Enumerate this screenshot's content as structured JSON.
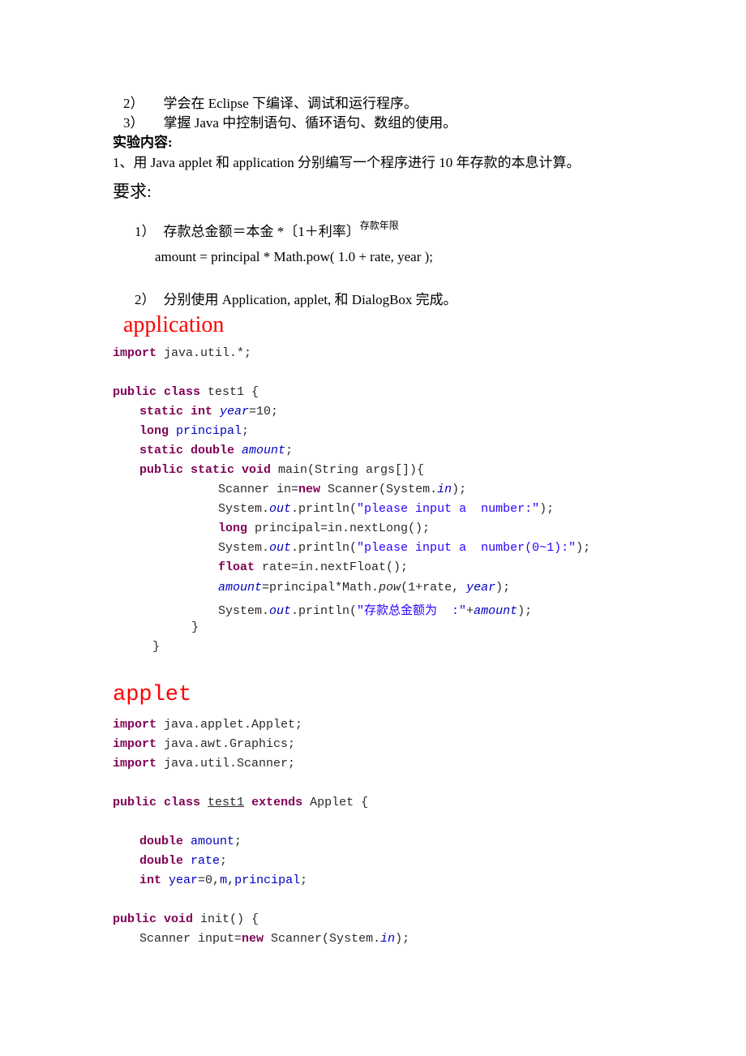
{
  "objectives": [
    {
      "num": "2）",
      "text": "学会在 Eclipse 下编译、调试和运行程序。"
    },
    {
      "num": "3）",
      "text": "掌握 Java 中控制语句、循环语句、数组的使用。"
    }
  ],
  "content_heading": "实验内容:",
  "task1": "1、用 Java applet 和 application 分别编写一个程序进行 10 年存款的本息计算。",
  "requirements_heading": "要求:",
  "req1": {
    "num": "1）",
    "text": "存款总金额＝本金 *〔1＋利率〕",
    "superscript": "存款年限"
  },
  "formula": "amount = principal * Math.pow( 1.0 + rate, year );",
  "req2": {
    "num": "2）",
    "text": "分别使用 Application, applet, 和 DialogBox 完成。"
  },
  "application": {
    "title": "application",
    "l1": {
      "kw": "import",
      "rest": " java.util.*;"
    },
    "l2": {
      "kw": "public class",
      "rest": " test1 {"
    },
    "l3": {
      "kw": "static int",
      "fld": "year",
      "rest": "=10;"
    },
    "l4": {
      "kw": "long",
      "fld": "principal",
      "rest": ";"
    },
    "l5": {
      "kw": "static double",
      "fld": "amount",
      "rest": ";"
    },
    "l6": {
      "kw": "public static void",
      "rest": " main(String args[]){"
    },
    "l7": {
      "a": "Scanner in=",
      "kw": "new",
      "b": " Scanner(System.",
      "fi": "in",
      "c": ");"
    },
    "l8": {
      "a": "System.",
      "fi": "out",
      "b": ".println(",
      "str": "\"please input a  number:\"",
      "c": ");"
    },
    "l9": {
      "kw": "long",
      "rest": " principal=in.nextLong();"
    },
    "l10": {
      "a": "System.",
      "fi": "out",
      "b": ".println(",
      "str": "\"please input a  number(0~1):\"",
      "c": ");"
    },
    "l11": {
      "kw": "float",
      "rest": " rate=in.nextFloat();"
    },
    "l12": {
      "fi": "amount",
      "a": "=principal*Math.",
      "it": "pow",
      "b": "(1+rate, ",
      "fi2": "year",
      "c": ");"
    },
    "l13": {
      "a": "System.",
      "fi": "out",
      "b": ".println(",
      "str": "\"存款总金额为  :\"",
      "c": "+",
      "fi2": "amount",
      "d": ");"
    },
    "l14": "}",
    "l15": "}"
  },
  "applet": {
    "title": "applet",
    "l1": {
      "kw": "import",
      "rest": " java.applet.Applet;"
    },
    "l2": {
      "kw": "import",
      "rest": " java.awt.Graphics;"
    },
    "l3": {
      "kw": "import",
      "rest": " java.util.Scanner;"
    },
    "l4": {
      "kw": "public class",
      "ul": "test1",
      "kw2": "extends",
      "rest": " Applet {"
    },
    "l5": {
      "kw": "double",
      "fld": "amount",
      "rest": ";"
    },
    "l6": {
      "kw": "double",
      "fld": "rate",
      "rest": ";"
    },
    "l7": {
      "kw": "int",
      "fld": "year",
      "a": "=0,",
      "fld2": "m",
      "b": ",",
      "fld3": "principal",
      "c": ";"
    },
    "l8": {
      "kw": "public void",
      "rest": " init() {"
    },
    "l9": {
      "a": "Scanner input=",
      "kw": "new",
      "b": " Scanner(System.",
      "fi": "in",
      "c": ");"
    }
  }
}
